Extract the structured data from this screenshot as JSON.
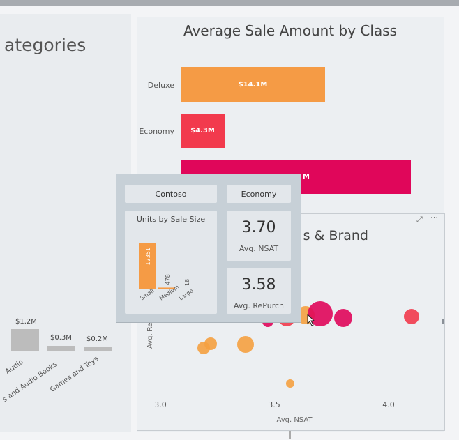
{
  "left_panel": {
    "title": "ategories",
    "categories": [
      {
        "label": "Audio",
        "value_label": "$1.2M",
        "value": 1.2
      },
      {
        "label": "s and Audio Books",
        "value_label": "$0.3M",
        "value": 0.3
      },
      {
        "label": "Games and Toys",
        "value_label": "$0.2M",
        "value": 0.2
      }
    ]
  },
  "bar_chart": {
    "title": "Average Sale Amount by Class",
    "rows": [
      {
        "label": "Deluxe",
        "value_label": "$14.1M",
        "value": 14.1,
        "color": "#f59b45"
      },
      {
        "label": "Economy",
        "value_label": "$4.3M",
        "value": 4.3,
        "color": "#f23a4d"
      },
      {
        "label": "",
        "value_label": "M",
        "value": 22.5,
        "color": "#e0065a"
      }
    ]
  },
  "scatter": {
    "title": "s & Brand",
    "xlabel": "Avg. NSAT",
    "ylabel": "Avg. Re",
    "xticks": [
      "3.0",
      "3.5",
      "4.0"
    ],
    "xlim": [
      2.9,
      4.2
    ],
    "colors": {
      "orange": "#f5a040",
      "red": "#f23a4d",
      "magenta": "#e0065a"
    }
  },
  "tooltip": {
    "brand": "Contoso",
    "class": "Economy",
    "units_title": "Units by Sale Size",
    "units": [
      {
        "label": "Small",
        "value": 12351
      },
      {
        "label": "Medium",
        "value": 478
      },
      {
        "label": "Large",
        "value": 18
      }
    ],
    "nsat": {
      "value": "3.70",
      "label": "Avg. NSAT"
    },
    "repurch": {
      "value": "3.58",
      "label": "Avg. RePurch"
    }
  },
  "icons": {
    "focus": "focus-mode-icon",
    "more": "more-options-icon"
  }
}
